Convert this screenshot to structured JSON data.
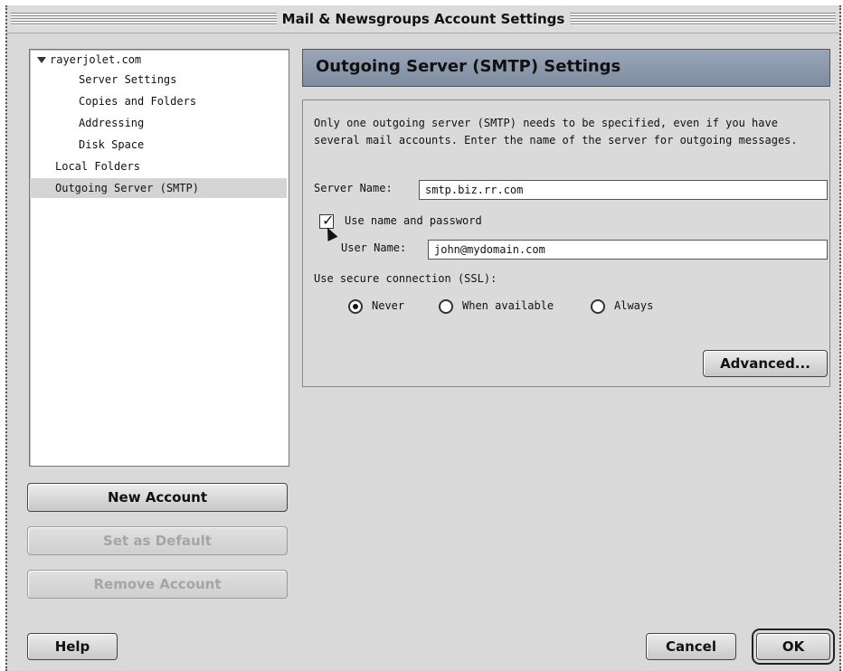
{
  "window": {
    "title": "Mail & Newsgroups Account Settings"
  },
  "tree": {
    "account": "rayerjolet.com",
    "items": [
      {
        "label": "Server Settings"
      },
      {
        "label": "Copies and Folders"
      },
      {
        "label": "Addressing"
      },
      {
        "label": "Disk Space"
      },
      {
        "label": "Local Folders"
      },
      {
        "label": "Outgoing Server (SMTP)"
      }
    ]
  },
  "account_buttons": {
    "new_account": "New Account",
    "set_default": "Set as Default",
    "remove_account": "Remove Account"
  },
  "panel": {
    "heading": "Outgoing Server (SMTP) Settings",
    "description": "Only one outgoing server (SMTP) needs to be specified, even if you have several mail accounts. Enter the name of the server for outgoing messages.",
    "server_name_label": "Server Name:",
    "server_name_value": "smtp.biz.rr.com",
    "use_auth_label": "Use name and password",
    "use_auth_checked": true,
    "user_name_label": "User Name:",
    "user_name_value": "john@mydomain.com",
    "ssl_label": "Use secure connection (SSL):",
    "ssl_options": [
      {
        "label": "Never",
        "selected": true
      },
      {
        "label": "When available",
        "selected": false
      },
      {
        "label": "Always",
        "selected": false
      }
    ],
    "advanced_button": "Advanced..."
  },
  "footer": {
    "help": "Help",
    "cancel": "Cancel",
    "ok": "OK"
  }
}
